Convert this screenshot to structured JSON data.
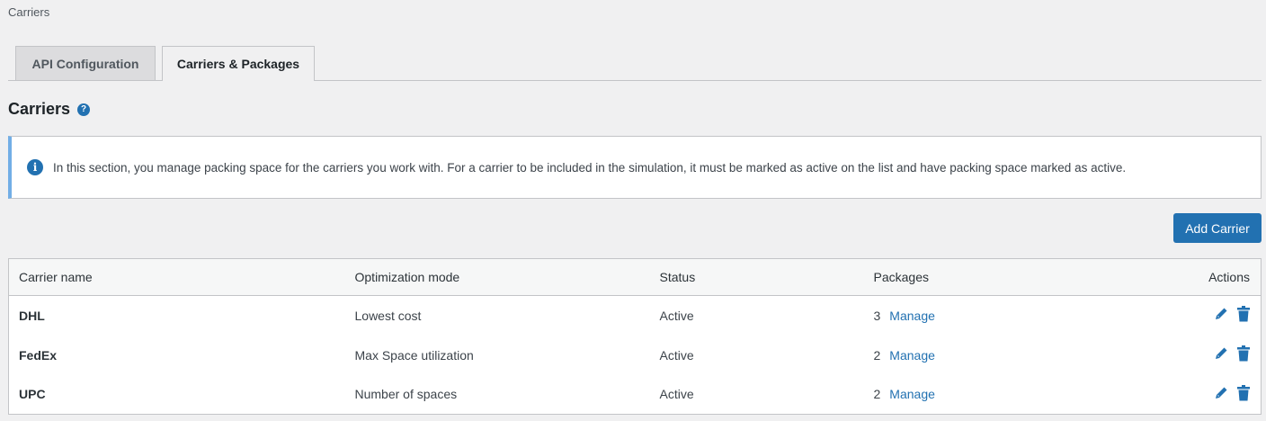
{
  "breadcrumb": "Carriers",
  "tabs": [
    {
      "label": "API Configuration",
      "active": false
    },
    {
      "label": "Carriers & Packages",
      "active": true
    }
  ],
  "heading": "Carriers",
  "help_icon": "question-circle-icon",
  "notice": "In this section, you manage packing space for the carriers you work with. For a carrier to be included in the simulation, it must be marked as active on the list and have packing space marked as active.",
  "add_button": "Add Carrier",
  "table": {
    "headers": [
      "Carrier name",
      "Optimization mode",
      "Status",
      "Packages",
      "Actions"
    ],
    "rows": [
      {
        "name": "DHL",
        "mode": "Lowest cost",
        "status": "Active",
        "packages": "3",
        "link": "Manage"
      },
      {
        "name": "FedEx",
        "mode": "Max Space utilization",
        "status": "Active",
        "packages": "2",
        "link": "Manage"
      },
      {
        "name": "UPC",
        "mode": "Number of spaces",
        "status": "Active",
        "packages": "2",
        "link": "Manage"
      }
    ]
  },
  "colors": {
    "accent": "#2271b1",
    "notice_border": "#72aee6"
  }
}
